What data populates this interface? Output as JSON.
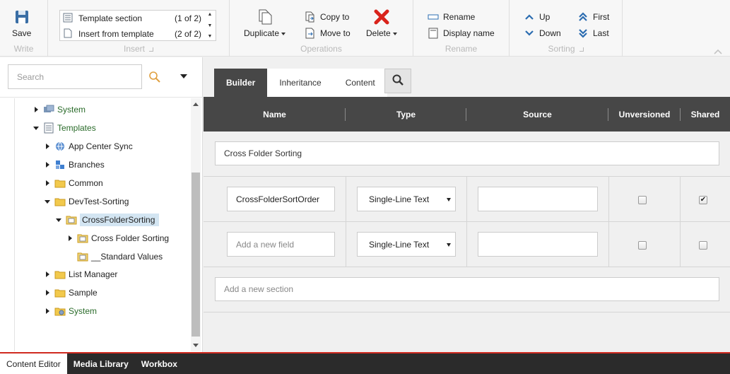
{
  "ribbon": {
    "write": {
      "label": "Write",
      "save_label": "Save"
    },
    "insert": {
      "label": "Insert",
      "items": [
        {
          "label": "Template section",
          "count": "(1 of 2)"
        },
        {
          "label": "Insert from template",
          "count": "(2 of 2)"
        }
      ]
    },
    "operations": {
      "label": "Operations",
      "duplicate_label": "Duplicate",
      "copy_to_label": "Copy to",
      "move_to_label": "Move to",
      "delete_label": "Delete"
    },
    "rename": {
      "label": "Rename",
      "rename_label": "Rename",
      "display_name_label": "Display name"
    },
    "sorting": {
      "label": "Sorting",
      "up_label": "Up",
      "down_label": "Down",
      "first_label": "First",
      "last_label": "Last"
    }
  },
  "search": {
    "placeholder": "Search"
  },
  "tree": [
    {
      "label": "System",
      "icon": "system-icon",
      "green": true,
      "expanded": false,
      "level": 0
    },
    {
      "label": "Templates",
      "icon": "templates-icon",
      "green": true,
      "expanded": true,
      "level": 0
    },
    {
      "label": "App Center Sync",
      "icon": "globe-icon",
      "green": false,
      "expanded": false,
      "level": 1
    },
    {
      "label": "Branches",
      "icon": "branches-icon",
      "green": false,
      "expanded": false,
      "level": 1
    },
    {
      "label": "Common",
      "icon": "folder-icon",
      "green": false,
      "expanded": false,
      "level": 1
    },
    {
      "label": "DevTest-Sorting",
      "icon": "folder-icon",
      "green": false,
      "expanded": true,
      "level": 1
    },
    {
      "label": "CrossFolderSorting",
      "icon": "template-icon",
      "green": false,
      "expanded": true,
      "level": 2,
      "selected": true
    },
    {
      "label": "Cross Folder Sorting",
      "icon": "template-icon",
      "green": false,
      "expanded": false,
      "level": 3
    },
    {
      "label": "__Standard Values",
      "icon": "template-icon",
      "green": false,
      "level": 3
    },
    {
      "label": "List Manager",
      "icon": "folder-icon",
      "green": false,
      "expanded": false,
      "level": 1
    },
    {
      "label": "Sample",
      "icon": "folder-icon",
      "green": false,
      "expanded": false,
      "level": 1
    },
    {
      "label": "System",
      "icon": "system-folder-icon",
      "green": true,
      "expanded": false,
      "level": 1
    }
  ],
  "editor": {
    "tabs": [
      {
        "label": "Builder",
        "active": true
      },
      {
        "label": "Inheritance",
        "active": false
      },
      {
        "label": "Content",
        "active": false
      }
    ],
    "columns": [
      "Name",
      "Type",
      "Source",
      "Unversioned",
      "Shared"
    ],
    "section_name": "Cross Folder Sorting",
    "fields": [
      {
        "name": "CrossFolderSortOrder",
        "type": "Single-Line Text",
        "source": "",
        "unversioned": false,
        "shared": true
      },
      {
        "name": "Add a new field",
        "type": "Single-Line Text",
        "source": "",
        "unversioned": false,
        "shared": false,
        "placeholder": true
      }
    ],
    "new_section_placeholder": "Add a new section"
  },
  "bottom_tabs": [
    {
      "label": "Content Editor",
      "active": true
    },
    {
      "label": "Media Library",
      "active": false
    },
    {
      "label": "Workbox",
      "active": false
    }
  ],
  "colors": {
    "accent_red": "#d02b20",
    "header_dark": "#474747",
    "tree_green": "#2a6b2a",
    "selection": "#d3e5f2"
  }
}
